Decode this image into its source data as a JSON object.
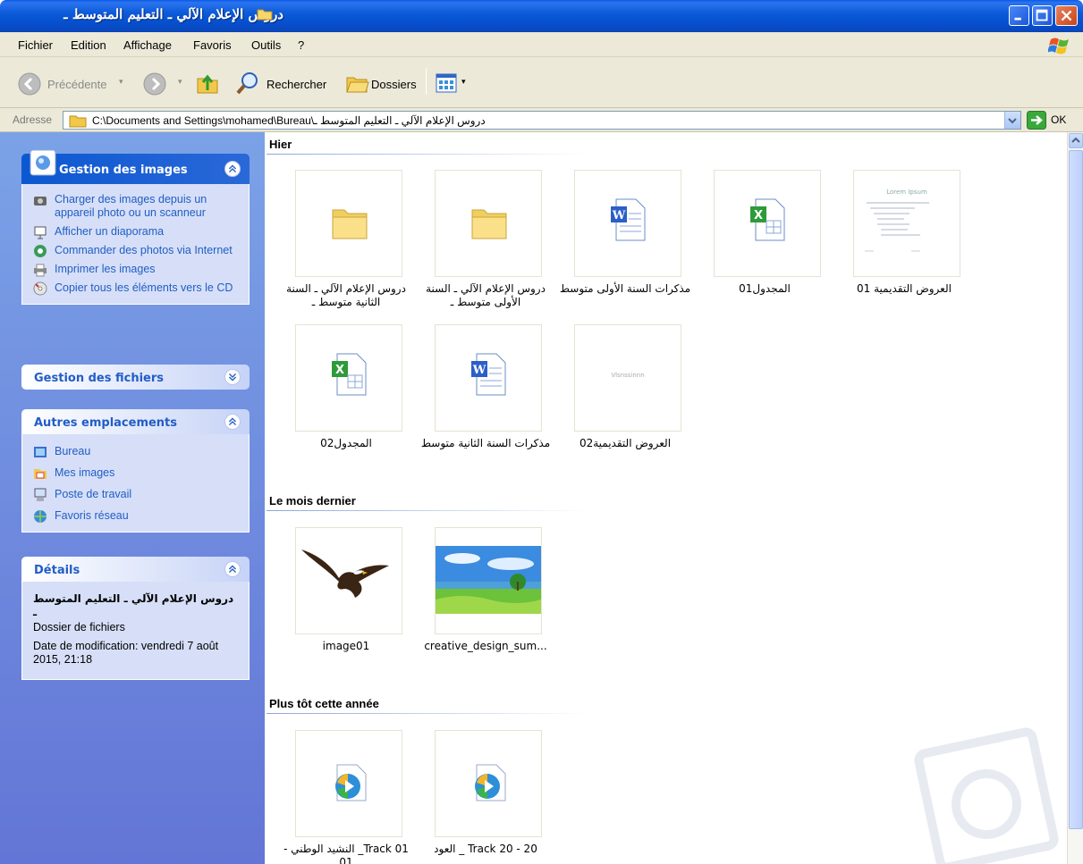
{
  "window": {
    "title": "دروس الإعلام الآلي ـ التعليم المتوسط ـ"
  },
  "menu": {
    "items": [
      "Fichier",
      "Edition",
      "Affichage",
      "Favoris",
      "Outils",
      "?"
    ]
  },
  "toolbar": {
    "back_label": "Précédente",
    "search_label": "Rechercher",
    "folders_label": "Dossiers"
  },
  "address": {
    "label": "Adresse",
    "path": "C:\\Documents and Settings\\mohamed\\Bureau\\دروس الإعلام الآلي ـ التعليم المتوسط ـ",
    "go_label": "OK"
  },
  "taskpane": {
    "image_tasks": {
      "title": "Gestion des images",
      "items": [
        {
          "label": "Charger des images depuis un appareil photo ou un scanneur",
          "icon": "camera-icon"
        },
        {
          "label": "Afficher un diaporama",
          "icon": "slideshow-icon"
        },
        {
          "label": "Commander des photos via Internet",
          "icon": "globe-icon"
        },
        {
          "label": "Imprimer les images",
          "icon": "printer-icon"
        },
        {
          "label": "Copier tous les éléments vers le CD",
          "icon": "cd-icon"
        }
      ]
    },
    "file_tasks": {
      "title": "Gestion des fichiers"
    },
    "other_places": {
      "title": "Autres emplacements",
      "items": [
        {
          "label": "Bureau",
          "icon": "desktop-icon"
        },
        {
          "label": "Mes images",
          "icon": "my-pictures-icon"
        },
        {
          "label": "Poste de travail",
          "icon": "my-computer-icon"
        },
        {
          "label": "Favoris réseau",
          "icon": "network-icon"
        }
      ]
    },
    "details": {
      "title": "Détails",
      "name": "دروس الإعلام الآلي ـ التعليم المتوسط ـ",
      "type": "Dossier de fichiers",
      "modified": "Date de modification: vendredi 7 août 2015, 21:18"
    }
  },
  "groups": [
    {
      "header": "Hier",
      "items": [
        {
          "label": "دروس الإعلام الآلي ـ السنة الثانية متوسط ـ",
          "kind": "folder"
        },
        {
          "label": "دروس الإعلام الآلي ـ السنة الأولى متوسط ـ",
          "kind": "folder"
        },
        {
          "label": "مذكرات السنة الأولى متوسط",
          "kind": "word"
        },
        {
          "label": "المجدول01",
          "kind": "excel"
        },
        {
          "label": "العروض التقديمية 01",
          "kind": "slide-lorem",
          "thumb_text": "Lorem Ipsum"
        },
        {
          "label": "المجدول02",
          "kind": "excel"
        },
        {
          "label": "مذكرات السنة الثانية متوسط",
          "kind": "word"
        },
        {
          "label": "العروض التقديمية02",
          "kind": "slide-blank",
          "thumb_text": "Vlsnssinnn"
        }
      ]
    },
    {
      "header": "Le mois dernier",
      "items": [
        {
          "label": "image01",
          "kind": "eagle"
        },
        {
          "label": "creative_design_sum...",
          "kind": "landscape"
        }
      ]
    },
    {
      "header": "Plus tôt cette année",
      "items": [
        {
          "label": "Track 01_ النشيد الوطني - 01",
          "kind": "media"
        },
        {
          "label": "Track 20 - 20 _ العود",
          "kind": "media"
        }
      ]
    }
  ],
  "colors": {
    "titlebar": "#0a58e6",
    "taskpane": "#6f8ddd",
    "link": "#215dc6"
  }
}
